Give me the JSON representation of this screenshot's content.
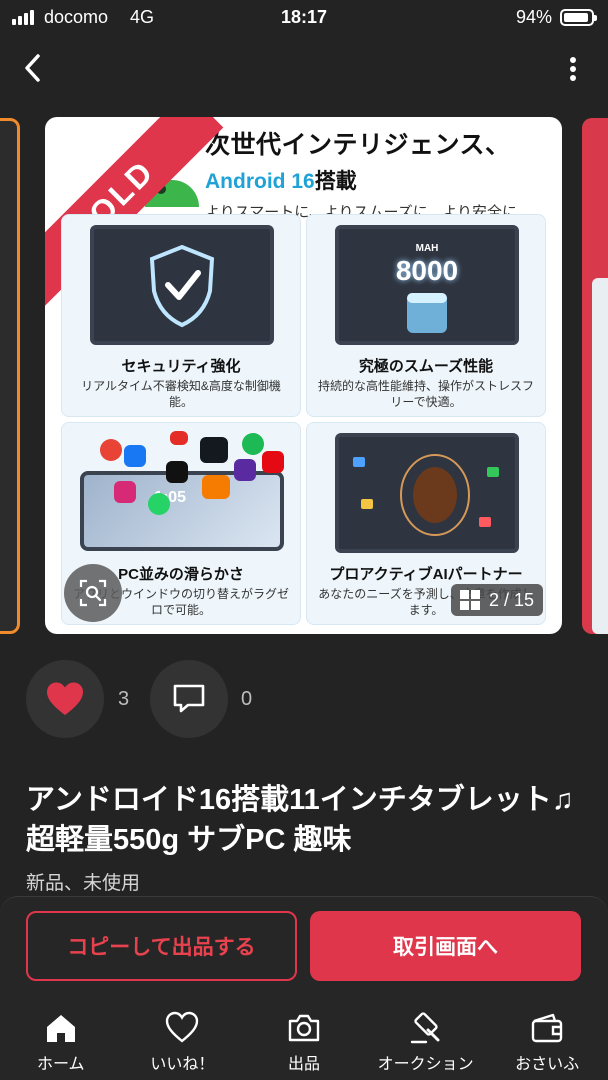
{
  "status_bar": {
    "carrier": "docomo",
    "network": "4G",
    "time": "18:17",
    "battery": "94%"
  },
  "listing": {
    "sold_badge": "SOLD",
    "image_headline": "次世代インテリジェンス、",
    "image_android_prefix": "Android 16",
    "image_android_suffix": "搭載",
    "image_subline": "よりスマートに、よりスムーズに、より安全に",
    "features": [
      {
        "title": "セキュリティ強化",
        "desc": "リアルタイム不審検知&高度な制御機能。"
      },
      {
        "title": "究極のスムーズ性能",
        "desc": "持続的な高性能維持、操作がストレスフリーで快適。"
      },
      {
        "title": "PC並みの滑らかさ",
        "desc": "アプリとウインドウの切り替えがラグゼロで可能。"
      },
      {
        "title": "プロアクティブAIパートナー",
        "desc": "あなたのニーズを予測し、文章を作成します。"
      }
    ],
    "battery_unit": "MAH",
    "battery_value": "8000",
    "tablet_time": "1:05",
    "page_indicator": "2 / 15",
    "likes": "3",
    "comments": "0",
    "title": "アンドロイド16搭載11インチタブレット♫ 超軽量550g サブPC 趣味",
    "condition": "新品、未使用"
  },
  "actions": {
    "copy_label": "コピーして出品する",
    "trade_label": "取引画面へ"
  },
  "tabbar": [
    {
      "label": "ホーム",
      "icon": "home-icon"
    },
    {
      "label": "いいね！",
      "icon": "heart-outline-icon"
    },
    {
      "label": "出品",
      "icon": "camera-icon"
    },
    {
      "label": "オークション",
      "icon": "gavel-icon"
    },
    {
      "label": "おさいふ",
      "icon": "wallet-icon"
    }
  ],
  "colors": {
    "background": "#232323",
    "accent_red": "#e0364c",
    "android_blue": "#1fa2d6",
    "sold_ribbon": "#e0364c"
  }
}
